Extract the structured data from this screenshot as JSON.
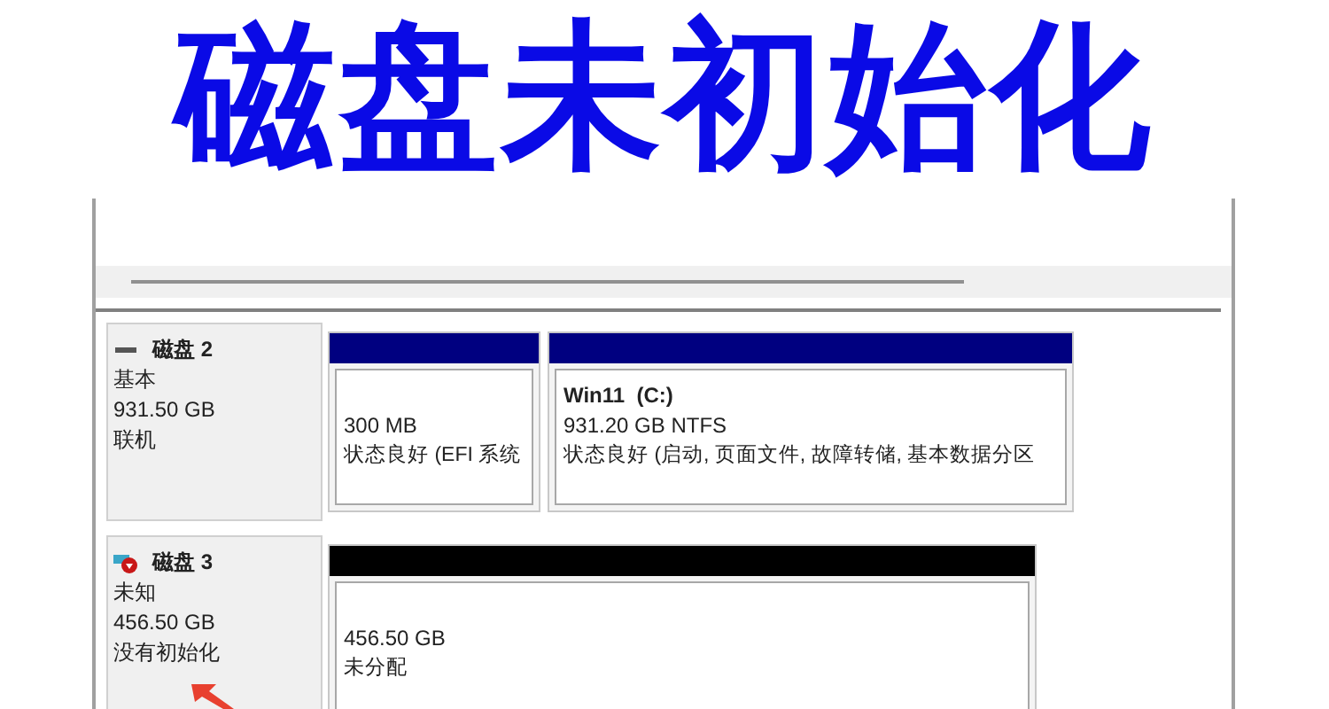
{
  "headline": "磁盘未初始化",
  "disks": [
    {
      "name": "磁盘 2",
      "kind": "online",
      "type": "基本",
      "size": "931.50 GB",
      "status": "联机",
      "partitions": [
        {
          "kind": "primary",
          "size": "300 MB",
          "status": "状态良好 (EFI 系统"
        },
        {
          "kind": "primary",
          "label": "Win11  (C:)",
          "size": "931.20 GB NTFS",
          "status": "状态良好 (启动, 页面文件, 故障转储, 基本数据分区"
        }
      ]
    },
    {
      "name": "磁盘 3",
      "kind": "error",
      "type": "未知",
      "size": "456.50 GB",
      "status": "没有初始化",
      "partitions": [
        {
          "kind": "unallocated",
          "size": "456.50 GB",
          "status": "未分配"
        }
      ]
    }
  ],
  "annotation": {
    "kind": "arrow"
  }
}
